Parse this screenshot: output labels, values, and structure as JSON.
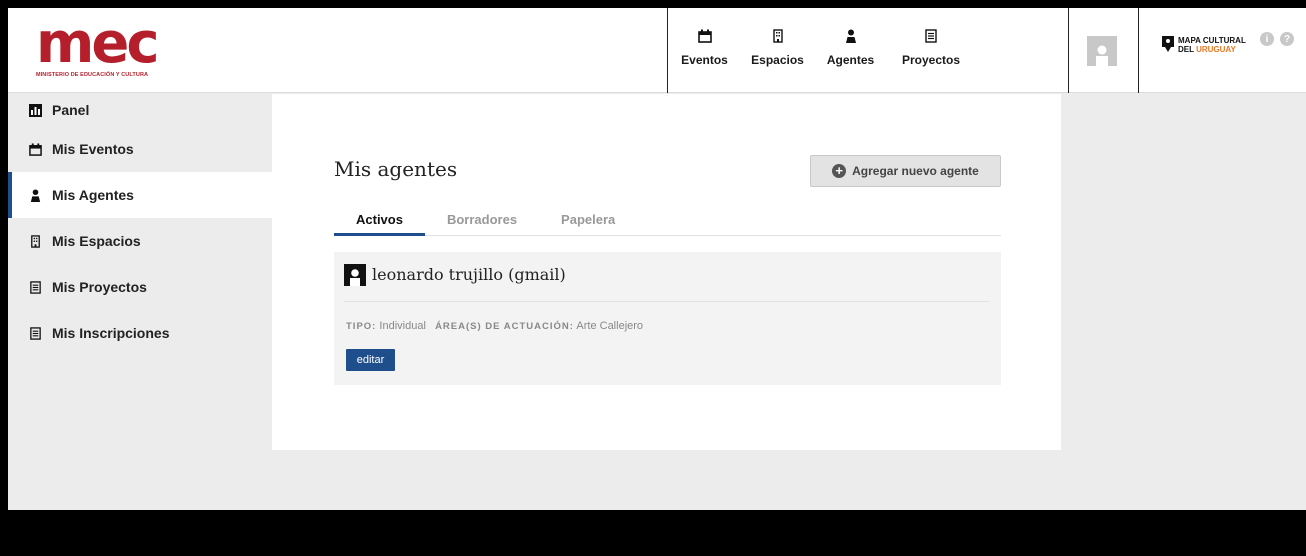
{
  "logo": {
    "word": "mec",
    "subtitle": "MINISTERIO DE EDUCACIÓN Y CULTURA"
  },
  "nav": [
    {
      "label": "Eventos",
      "icon": "calendar-icon"
    },
    {
      "label": "Espacios",
      "icon": "building-icon"
    },
    {
      "label": "Agentes",
      "icon": "person-icon"
    },
    {
      "label": "Proyectos",
      "icon": "document-icon"
    }
  ],
  "brand": {
    "line1": "MAPA CULTURAL",
    "line2a": "DEL",
    "line2b": "URUGUAY"
  },
  "help": {
    "info": "i",
    "question": "?"
  },
  "sidebar": {
    "items": [
      {
        "label": "Panel",
        "icon": "panel-icon"
      },
      {
        "label": "Mis Eventos",
        "icon": "calendar-icon"
      },
      {
        "label": "Mis Agentes",
        "icon": "person-icon"
      },
      {
        "label": "Mis Espacios",
        "icon": "building-icon"
      },
      {
        "label": "Mis Proyectos",
        "icon": "document-icon"
      },
      {
        "label": "Mis Inscripciones",
        "icon": "document-icon"
      }
    ]
  },
  "main": {
    "title": "Mis agentes",
    "add_button": "Agregar nuevo agente",
    "tabs": [
      {
        "label": "Activos"
      },
      {
        "label": "Borradores"
      },
      {
        "label": "Papelera"
      }
    ],
    "agent": {
      "name": "leonardo trujillo (gmail)",
      "tipo_key": "TIPO:",
      "tipo_val": "Individual",
      "area_key": "ÁREA(S) DE ACTUACIÓN:",
      "area_val": "Arte Callejero",
      "edit": "editar"
    }
  },
  "colors": {
    "brand_red": "#b51f2b",
    "accent_blue": "#1f4e8c",
    "uruguay_orange": "#e87722"
  }
}
